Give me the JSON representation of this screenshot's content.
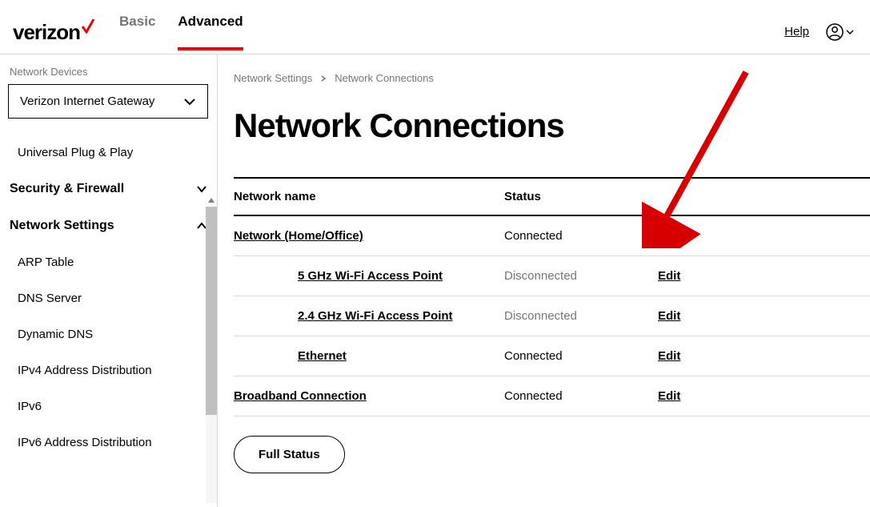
{
  "header": {
    "brand": "verizon",
    "tabs": {
      "basic": "Basic",
      "advanced": "Advanced"
    },
    "help": "Help"
  },
  "sidebar": {
    "devices_label": "Network Devices",
    "device_selected": "Verizon Internet Gateway",
    "item_upnp": "Universal Plug & Play",
    "cat_security": "Security & Firewall",
    "cat_network": "Network Settings",
    "item_arp": "ARP Table",
    "item_dns": "DNS Server",
    "item_ddns": "Dynamic DNS",
    "item_ipv4": "IPv4 Address Distribution",
    "item_ipv6": "IPv6",
    "item_ipv6dist": "IPv6 Address Distribution"
  },
  "content": {
    "breadcrumb_root": "Network Settings",
    "breadcrumb_current": "Network Connections",
    "title": "Network Connections",
    "col_name": "Network name",
    "col_status": "Status",
    "edit": "Edit",
    "rows": [
      {
        "name": "Network (Home/Office)",
        "status": "Connected",
        "indent": false,
        "disconnected": false
      },
      {
        "name": "5 GHz Wi-Fi Access Point",
        "status": "Disconnected",
        "indent": true,
        "disconnected": true
      },
      {
        "name": "2.4 GHz Wi-Fi Access Point",
        "status": "Disconnected",
        "indent": true,
        "disconnected": true
      },
      {
        "name": "Ethernet",
        "status": "Connected",
        "indent": true,
        "disconnected": false
      },
      {
        "name": "Broadband Connection",
        "status": "Connected",
        "indent": false,
        "disconnected": false
      }
    ],
    "full_status": "Full Status"
  }
}
